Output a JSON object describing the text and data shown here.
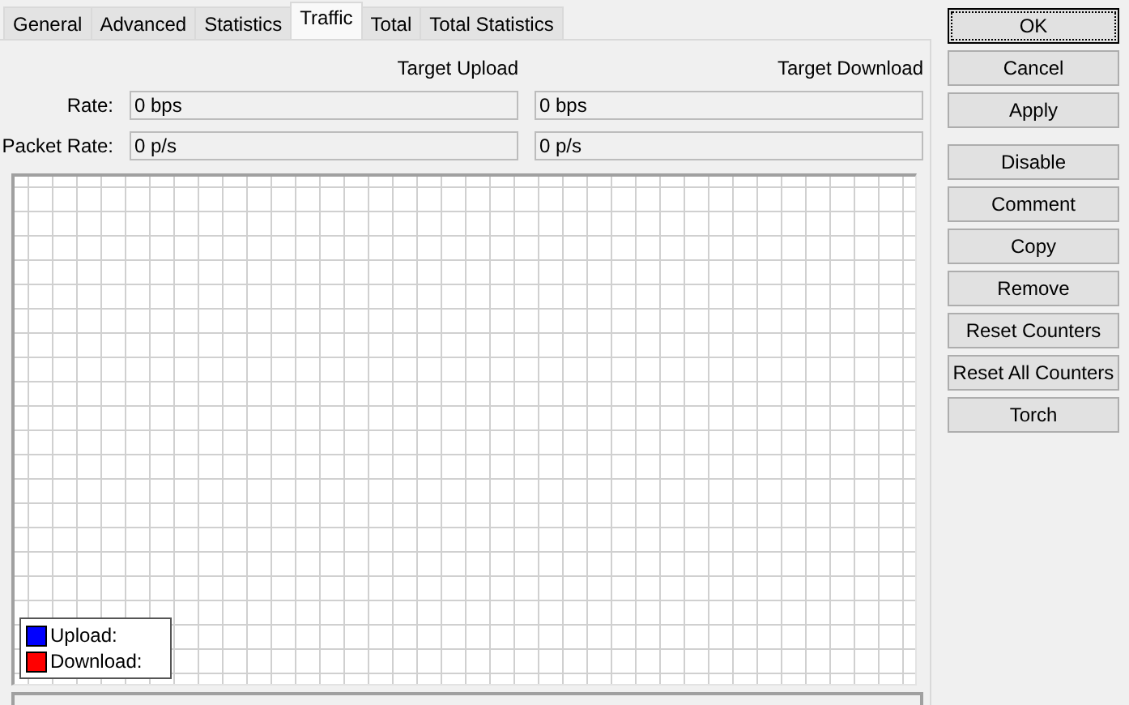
{
  "tabs": [
    {
      "label": "General",
      "selected": false
    },
    {
      "label": "Advanced",
      "selected": false
    },
    {
      "label": "Statistics",
      "selected": false
    },
    {
      "label": "Traffic",
      "selected": true
    },
    {
      "label": "Total",
      "selected": false
    },
    {
      "label": "Total Statistics",
      "selected": false
    }
  ],
  "columns": [
    "Target Upload",
    "Target Download"
  ],
  "rows": [
    {
      "label": "Rate:",
      "values": [
        "0 bps",
        "0 bps"
      ]
    },
    {
      "label": "Packet Rate:",
      "values": [
        "0 p/s",
        "0 p/s"
      ]
    }
  ],
  "legend": [
    {
      "label": "Upload:",
      "color": "#0000ff"
    },
    {
      "label": "Download:",
      "color": "#ff0000"
    }
  ],
  "button_groups": [
    [
      {
        "label": "OK",
        "default": true
      },
      {
        "label": "Cancel",
        "default": false
      },
      {
        "label": "Apply",
        "default": false
      }
    ],
    [
      {
        "label": "Disable",
        "default": false
      },
      {
        "label": "Comment",
        "default": false
      },
      {
        "label": "Copy",
        "default": false
      },
      {
        "label": "Remove",
        "default": false
      },
      {
        "label": "Reset Counters",
        "default": false
      },
      {
        "label": "Reset All Counters",
        "default": false
      },
      {
        "label": "Torch",
        "default": false
      }
    ]
  ]
}
